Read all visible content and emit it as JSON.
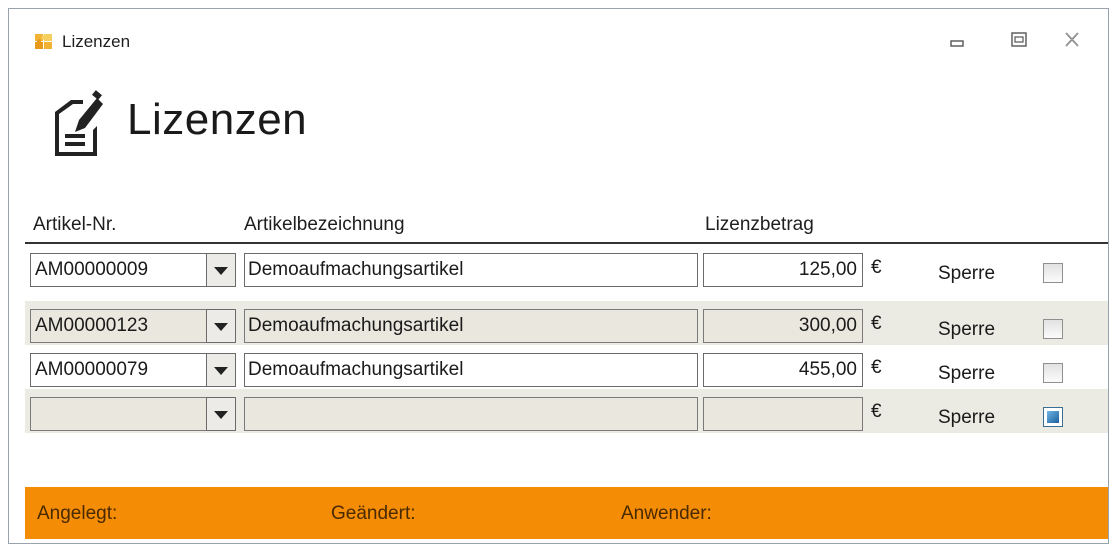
{
  "window": {
    "title": "Lizenzen"
  },
  "header": {
    "title": "Lizenzen"
  },
  "columns": {
    "artikel_nr": "Artikel-Nr.",
    "bezeichnung": "Artikelbezeichnung",
    "betrag": "Lizenzbetrag"
  },
  "rows": [
    {
      "artikel_nr": "AM00000009",
      "bezeichnung": "Demoaufmachungsartikel",
      "betrag": "125,00",
      "currency": "€",
      "sperre_label": "Sperre",
      "sperre_checked": false
    },
    {
      "artikel_nr": "AM00000123",
      "bezeichnung": "Demoaufmachungsartikel",
      "betrag": "300,00",
      "currency": "€",
      "sperre_label": "Sperre",
      "sperre_checked": false
    },
    {
      "artikel_nr": "AM00000079",
      "bezeichnung": "Demoaufmachungsartikel",
      "betrag": "455,00",
      "currency": "€",
      "sperre_label": "Sperre",
      "sperre_checked": false
    },
    {
      "artikel_nr": "",
      "bezeichnung": "",
      "betrag": "",
      "currency": "€",
      "sperre_label": "Sperre",
      "sperre_checked": true
    }
  ],
  "status": {
    "angelegt": "Angelegt:",
    "geaendert": "Geändert:",
    "anwender": "Anwender:"
  },
  "colors": {
    "status_bar": "#f48c06",
    "alt_row": "#ecebe3",
    "checkbox_active": "#1b5f9d"
  },
  "icons": {
    "app": "puzzle-icon",
    "page": "edit-document-icon",
    "minimize": "minimize-icon",
    "maximize": "maximize-icon",
    "close": "close-icon",
    "dropdown": "chevron-down-icon"
  }
}
